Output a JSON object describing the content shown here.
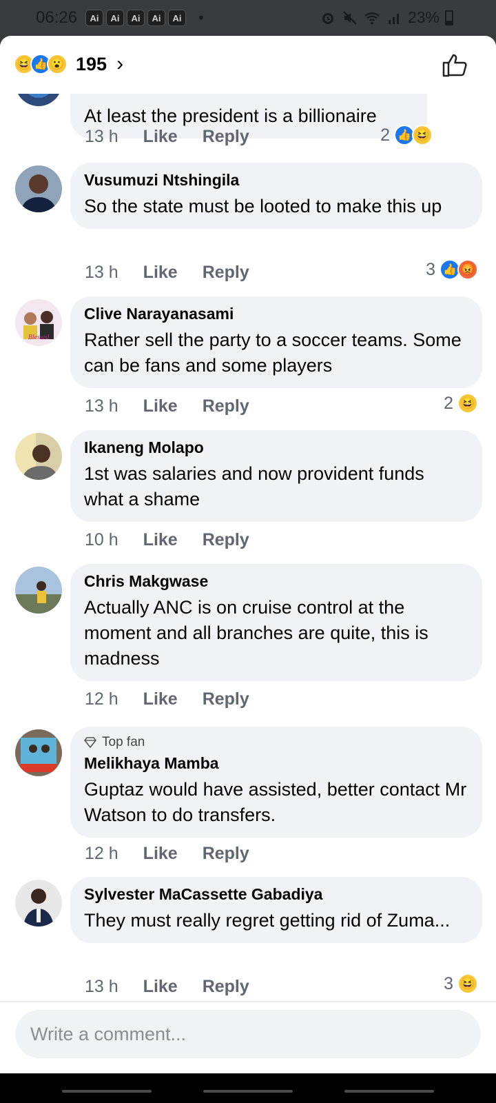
{
  "status_bar": {
    "time": "06:26",
    "ai_badges": [
      "Ai",
      "Ai",
      "Ai",
      "Ai",
      "Ai"
    ],
    "dot": "•",
    "battery": "23%"
  },
  "header": {
    "reaction_count": "195",
    "chevron": "›"
  },
  "comments": [
    {
      "author": "",
      "text": "At least the president is a billionaire",
      "time": "13 h",
      "like_label": "Like",
      "reply_label": "Reply",
      "reaction_count": "2",
      "reaction_icons": [
        "like-icon",
        "haha-icon"
      ]
    },
    {
      "author": "Vusumuzi Ntshingila",
      "text": "So the state must be looted to make this up",
      "time": "13 h",
      "like_label": "Like",
      "reply_label": "Reply",
      "reaction_count": "3",
      "reaction_icons": [
        "like-icon",
        "angry-icon"
      ]
    },
    {
      "author": "Clive Narayanasami",
      "text": "Rather sell the party to a soccer teams. Some can be fans and some players",
      "time": "13 h",
      "like_label": "Like",
      "reply_label": "Reply",
      "reaction_count": "2",
      "reaction_icons": [
        "haha-icon"
      ]
    },
    {
      "author": "Ikaneng Molapo",
      "text": "1st was salaries and now provident funds what a shame",
      "time": "10 h",
      "like_label": "Like",
      "reply_label": "Reply"
    },
    {
      "author": "Chris Makgwase",
      "text": "Actually ANC is on cruise control at the moment and all branches are quite, this is madness",
      "time": "12 h",
      "like_label": "Like",
      "reply_label": "Reply"
    },
    {
      "badge": "Top fan",
      "author": "Melikhaya Mamba",
      "text": "Guptaz would have assisted, better contact Mr Watson to do transfers.",
      "time": "12 h",
      "like_label": "Like",
      "reply_label": "Reply"
    },
    {
      "author": "Sylvester MaCassette Gabadiya",
      "text": "They must really regret getting rid of Zuma...",
      "time": "13 h",
      "like_label": "Like",
      "reply_label": "Reply",
      "reaction_count": "3",
      "reaction_icons": [
        "haha-icon"
      ]
    }
  ],
  "composer": {
    "placeholder": "Write a comment..."
  },
  "colors": {
    "facebook_blue": "#1877f2",
    "bubble_bg": "#f0f2f5",
    "meta_text": "#606770"
  }
}
